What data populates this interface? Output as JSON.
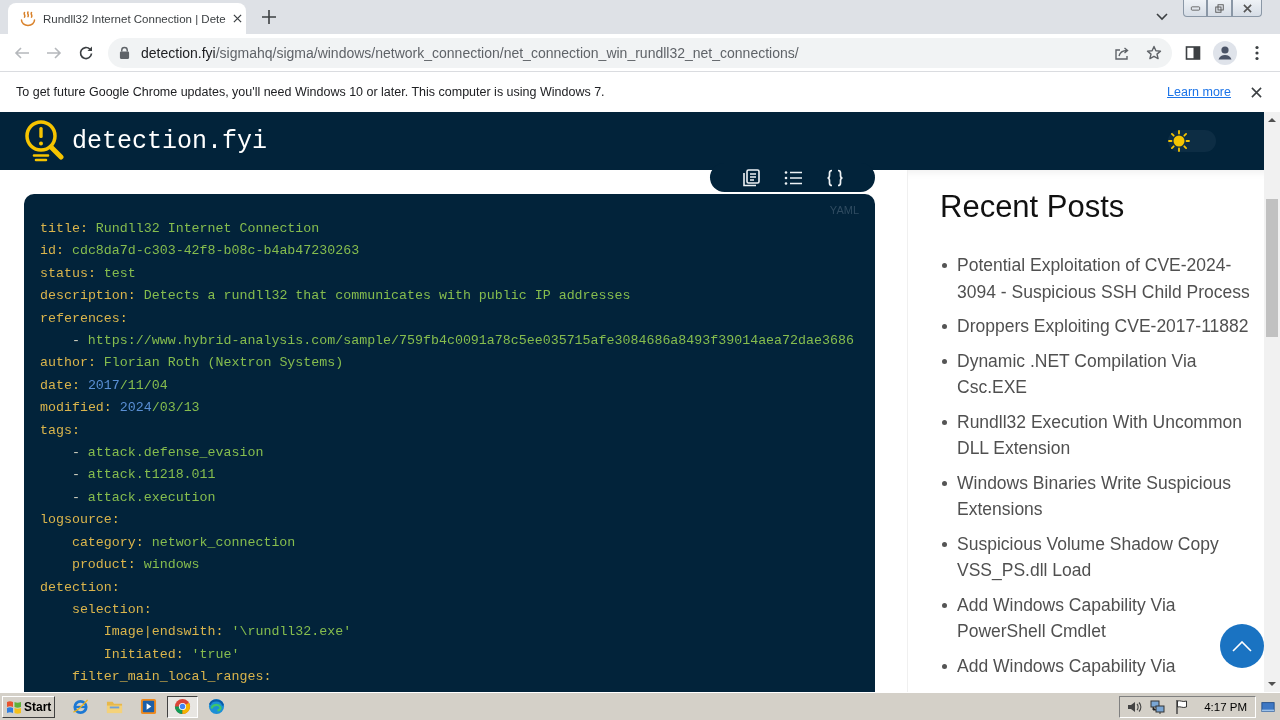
{
  "browser": {
    "tabs": [
      {
        "title": "Rundll32 Internet Connection | Dete",
        "selected": true
      }
    ],
    "nav": {
      "back": {
        "disabled": true
      },
      "forward": {
        "disabled": true
      }
    },
    "address": {
      "host": "detection.fyi",
      "path": "/sigmahq/sigma/windows/network_connection/net_connection_win_rundll32_net_connections/"
    }
  },
  "info_bar": {
    "message": "To get future Google Chrome updates, you'll need Windows 10 or later. This computer is using Windows 7.",
    "link": "Learn more"
  },
  "header": {
    "site_name": "detection.fyi",
    "theme_toggle": {
      "on": false
    }
  },
  "code": {
    "label": "YAML",
    "lines": [
      {
        "kind": "pair",
        "key": "title:",
        "value": "Rundll32 Internet Connection"
      },
      {
        "kind": "pair",
        "key": "id:",
        "value": "cdc8da7d-c303-42f8-b08c-b4ab47230263"
      },
      {
        "kind": "pair",
        "key": "status:",
        "value": "test"
      },
      {
        "kind": "pair",
        "key": "description:",
        "value": "Detects a rundll32 that communicates with public IP addresses"
      },
      {
        "kind": "pair",
        "key": "references:",
        "children": [
          {
            "kind": "item",
            "marker": "-",
            "value": "https://www.hybrid-analysis.com/sample/759fb4c0091a78c5ee035715afe3084686a8493f39014aea72dae3686"
          }
        ]
      },
      {
        "kind": "pair",
        "key": "author:",
        "value": "Florian Roth (Nextron Systems)"
      },
      {
        "kind": "date",
        "key": "date:",
        "number": "2017",
        "value": "/11/04"
      },
      {
        "kind": "date",
        "key": "modified:",
        "number": "2024",
        "value": "/03/13"
      },
      {
        "kind": "pair",
        "key": "tags:",
        "children": [
          {
            "kind": "item",
            "marker": "-",
            "value": "attack.defense_evasion"
          },
          {
            "kind": "item",
            "marker": "-",
            "value": "attack.t1218.011"
          },
          {
            "kind": "item",
            "marker": "-",
            "value": "attack.execution"
          }
        ]
      },
      {
        "kind": "pair",
        "key": "logsource:",
        "children": [
          {
            "kind": "pair",
            "key": "category:",
            "value": "network_connection"
          },
          {
            "kind": "pair",
            "key": "product:",
            "value": "windows"
          }
        ]
      },
      {
        "kind": "pair",
        "key": "detection:",
        "children": [
          {
            "kind": "pair",
            "key": "selection:",
            "children": [
              {
                "kind": "pair",
                "key": "Image|endswith:",
                "value": "'\\rundll32.exe'"
              },
              {
                "kind": "pair",
                "key": "Initiated:",
                "value": "'true'"
              }
            ]
          },
          {
            "kind": "pair",
            "key": "filter_main_local_ranges:"
          }
        ]
      }
    ]
  },
  "sidebar": {
    "title": "Recent Posts",
    "posts": [
      "Potential Exploitation of CVE-2024-3094 - Suspicious SSH Child Process",
      "Droppers Exploiting CVE-2017-11882",
      "Dynamic .NET Compilation Via Csc.EXE",
      "Rundll32 Execution With Uncommon DLL Extension",
      "Windows Binaries Write Suspicious Extensions",
      "Suspicious Volume Shadow Copy VSS_PS.dll Load",
      "Add Windows Capability Via PowerShell Cmdlet",
      "Add Windows Capability Via"
    ]
  },
  "taskbar": {
    "start": "Start",
    "apps": [
      {
        "selected": false
      },
      {
        "selected": false
      },
      {
        "selected": false
      },
      {
        "selected": true
      },
      {
        "selected": false
      }
    ],
    "clock": "4:17 PM"
  }
}
